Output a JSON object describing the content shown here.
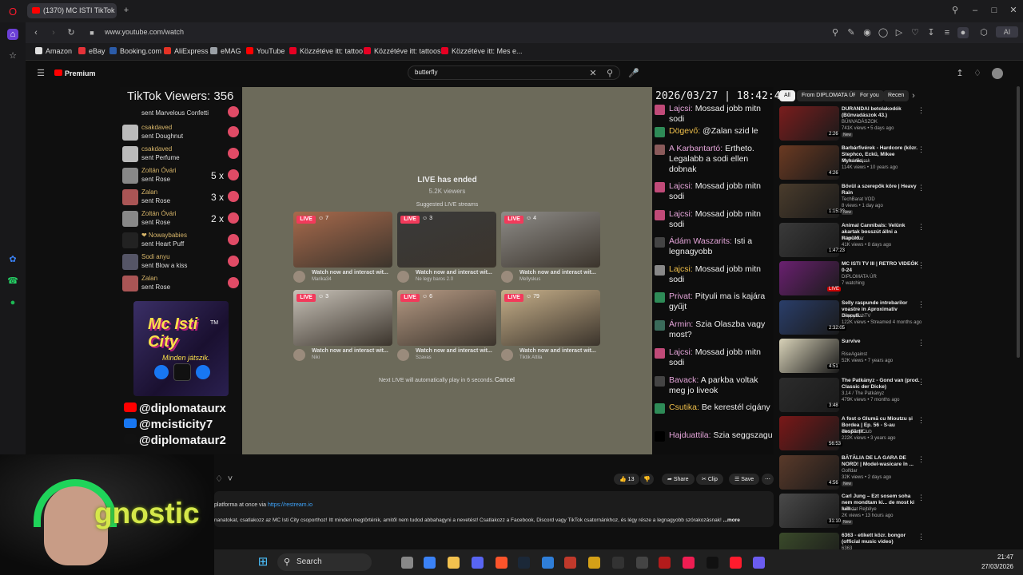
{
  "browser": {
    "tab_title": "(1370) MC ISTI TikTok Mil",
    "url": "www.youtube.com/watch",
    "bookmarks": [
      {
        "label": "Amazon",
        "color": "#e0e0e0"
      },
      {
        "label": "eBay",
        "color": "#e53238"
      },
      {
        "label": "Booking.com",
        "color": "#2b5ba8"
      },
      {
        "label": "AliExpress",
        "color": "#e43225"
      },
      {
        "label": "eMAG",
        "color": "#9aa0a6"
      },
      {
        "label": "YouTube",
        "color": "#ff0000"
      },
      {
        "label": "Közzétéve itt: tattoo",
        "color": "#e60023"
      },
      {
        "label": "Közzétéve itt: tattoos",
        "color": "#e60023"
      },
      {
        "label": "Közzétéve itt: Mes e...",
        "color": "#e60023"
      }
    ]
  },
  "youtube": {
    "logo": "Premium",
    "search_value": "butterfly"
  },
  "stream": {
    "viewers": "TikTok Viewers: 356",
    "gifts": [
      {
        "name": "",
        "action": "sent Marvelous Confetti",
        "count": ""
      },
      {
        "name": "csakdaved",
        "action": "sent Doughnut",
        "count": ""
      },
      {
        "name": "csakdaved",
        "action": "sent Perfume",
        "count": ""
      },
      {
        "name": "Zoltán Óvári",
        "action": "sent Rose",
        "count": "5 x"
      },
      {
        "name": "Zalan",
        "action": "sent Rose",
        "count": "3 x"
      },
      {
        "name": "Zoltán Óvári",
        "action": "sent Rose",
        "count": "2 x"
      },
      {
        "name": "❤ Nowaybabies",
        "action": "sent Heart Puff",
        "count": ""
      },
      {
        "name": "Sodi anyu",
        "action": "sent Blow a kiss",
        "count": ""
      },
      {
        "name": "Zalan",
        "action": "sent Rose",
        "count": ""
      }
    ],
    "promo_title": "Mc Isti City",
    "promo_tm": "TM",
    "promo_sub": "Minden játszik.",
    "socials": [
      {
        "handle": "@diplomataurx",
        "color": "#ff0000"
      },
      {
        "handle": "@mcisticity7",
        "color": "#1877f2"
      },
      {
        "handle": "@diplomataur2",
        "color": "#111111"
      }
    ],
    "ended_title": "LIVE has ended",
    "ended_viewers": "5.2K viewers",
    "suggested": "Suggested LIVE streams",
    "live_badge": "LIVE",
    "cards": [
      {
        "viewers": "7",
        "title": "Watch now and interact wit...",
        "creator": "Marika34",
        "color": "#a86a4c"
      },
      {
        "viewers": "3",
        "title": "Watch now and interact wit...",
        "creator": "Ne legy baros 2.0",
        "color": "#3a3a3a"
      },
      {
        "viewers": "4",
        "title": "Watch now and interact wit...",
        "creator": "Mellyskus",
        "color": "#8e8c88"
      },
      {
        "viewers": "3",
        "title": "Watch now and interact wit...",
        "creator": "Niki",
        "color": "#c8c2b8"
      },
      {
        "viewers": "6",
        "title": "Watch now and interact wit...",
        "creator": "Szavas",
        "color": "#b69a84"
      },
      {
        "viewers": "79",
        "title": "Watch now and interact wit...",
        "creator": "Tiktik Attila",
        "color": "#c7b08a"
      }
    ],
    "next_live": "Next LIVE will automatically play in 6 seconds.",
    "cancel": "Cancel",
    "clock": "2026/03/27 | 18:42:42",
    "chat": [
      {
        "user": "Lajcsi:",
        "text": "Mossad jobb mitn sodi"
      },
      {
        "user": "Dögevő:",
        "text": "@Zalan szid le"
      },
      {
        "user": "A Karbantartó:",
        "text": "Ertheto. Legalabb a sodi ellen dobnak"
      },
      {
        "user": "Lajcsi:",
        "text": "Mossad jobb mitn sodi"
      },
      {
        "user": "Lajcsi:",
        "text": "Mossad jobb mitn sodi"
      },
      {
        "user": "Ádám Waszarits:",
        "text": "Isti a legnagyobb"
      },
      {
        "user": "Lajcsi:",
        "text": "Mossad jobb mitn sodi"
      },
      {
        "user": "Privat:",
        "text": "Pityuli ma is kajára gyűjt"
      },
      {
        "user": "Ármin:",
        "text": "Szia Olaszba vagy most?"
      },
      {
        "user": "Lajcsi:",
        "text": "Mossad jobb mitn sodi"
      },
      {
        "user": "Bavack:",
        "text": "A parkba voltak meg jo liveok"
      },
      {
        "user": "Csutika:",
        "text": "Be kerestél cigány"
      },
      {
        "user": "Hajduattila:",
        "text": "Szia seggszagu"
      }
    ]
  },
  "sidebar": {
    "chips": [
      "All",
      "From DIPLOMATA ÚR",
      "For you",
      "Recen"
    ],
    "videos": [
      {
        "title": "DURANDAI betolakodók (Bűnvadászok 43.)",
        "channel": "BŰNVADÁSZOK",
        "meta": "741K views • 5 days ago",
        "duration": "2:26",
        "new": "New",
        "color": "#7a1d1d"
      },
      {
        "title": "Barbárfivérek - Hardcore (közr. Stephco, Eckü, Mikee Mykanic,...",
        "channel": "Barbárfivérek",
        "meta": "114K views • 10 years ago",
        "duration": "4:26",
        "new": "",
        "color": "#6b3a22"
      },
      {
        "title": "Bövül a szerepők köre | Heavy Rain",
        "channel": "TechBarat VOD",
        "meta": "8 views • 1 day ago",
        "duration": "1:15:30",
        "new": "New",
        "color": "#4a3c2c"
      },
      {
        "title": "Animal Cannibals: Velünk akartak bosszút állni a Rapülő...",
        "channel": "Telex After",
        "meta": "41K views • 8 days ago",
        "duration": "1:47:23",
        "new": "",
        "color": "#3a3a3a"
      },
      {
        "title": "MC ISTI TV III | RETRO VIDEÓK 0-24",
        "channel": "DIPLOMATA ÚR",
        "meta": "7 watching",
        "duration": "LIVE",
        "new": "",
        "color": "#6a2070"
      },
      {
        "title": "Selly raspunde intrebarilor voastre in Aproximativ Discuti...",
        "channel": "HappyFishTV",
        "meta": "122K views • Streamed 4 months ago",
        "duration": "2:32:05",
        "new": "",
        "color": "#2a3e6a"
      },
      {
        "title": "Survive",
        "channel": "RiseAgainst",
        "meta": "52K views • 7 years ago",
        "duration": "4:51",
        "new": "",
        "color": "#d8d2b8"
      },
      {
        "title": "The Patkányz - Gond van (prod. Classic der Dicke)",
        "channel": "3,14 / The Patkányz",
        "meta": "479K views • 7 months ago",
        "duration": "3:48",
        "new": "",
        "color": "#2c2c2c"
      },
      {
        "title": "A fost o Glumă cu Mioutzu și Bordea | Ep. 56 - S-au despărțit...",
        "channel": "The Fool Club",
        "meta": "222K views • 3 years ago",
        "duration": "56:53",
        "new": "",
        "color": "#7a1818"
      },
      {
        "title": "BĂTĂLIA DE LA GARA DE NORD! | Model-wasicare în ...",
        "channel": "Golfdar",
        "meta": "32K views • 2 days ago",
        "duration": "4:56",
        "new": "New",
        "color": "#5a3a2a"
      },
      {
        "title": "Carl Jung – Ezt sosem soha nem mondtam ki... de most ki kell ...",
        "channel": "A Tudat Rejtélye",
        "meta": "2K views • 13 hours ago",
        "duration": "31:10",
        "new": "New",
        "color": "#4a4a4a"
      },
      {
        "title": "6363 - etikett közr. bongor (official music video)",
        "channel": "6363",
        "meta": "132K views • 6 months ago",
        "duration": "2:36",
        "new": "",
        "color": "#3a4a2a"
      }
    ]
  },
  "actions": {
    "likes": "13",
    "share": "Share",
    "clip": "Clip",
    "save": "Save"
  },
  "description": {
    "line1_prefix": "platforma at once via",
    "line1_link": "https://restream.io",
    "line2": "nanatokat, csatlakozz az MC Isti City csoporthoz! Itt minden megtörténik, amitől nem tudod abbahagyni a nevetést! Csatlakozz a Facebook, Discord vagy TikTok csatornánkhoz, és légy része a legnagyobb szórakozásnak!",
    "more": "...more"
  },
  "webcam": {
    "overlay_text": "gnostic"
  },
  "taskbar": {
    "search": "Search",
    "time": "21:47",
    "date": "27/03/2026"
  }
}
